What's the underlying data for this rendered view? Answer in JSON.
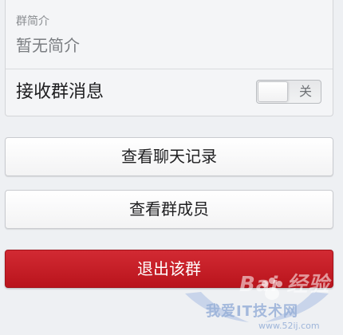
{
  "group_intro": {
    "caption": "群简介",
    "value": "暂无简介"
  },
  "receive_messages": {
    "label": "接收群消息",
    "toggle_state": "关"
  },
  "buttons": {
    "chat_history": "查看聊天记录",
    "members": "查看群成员",
    "quit": "退出该群"
  },
  "watermark": {
    "brand": "Bai 经验",
    "site": "我爱IT技术网",
    "url": "www.52ij.com"
  },
  "colors": {
    "danger": "#c41e25",
    "background": "#eef0f3"
  }
}
